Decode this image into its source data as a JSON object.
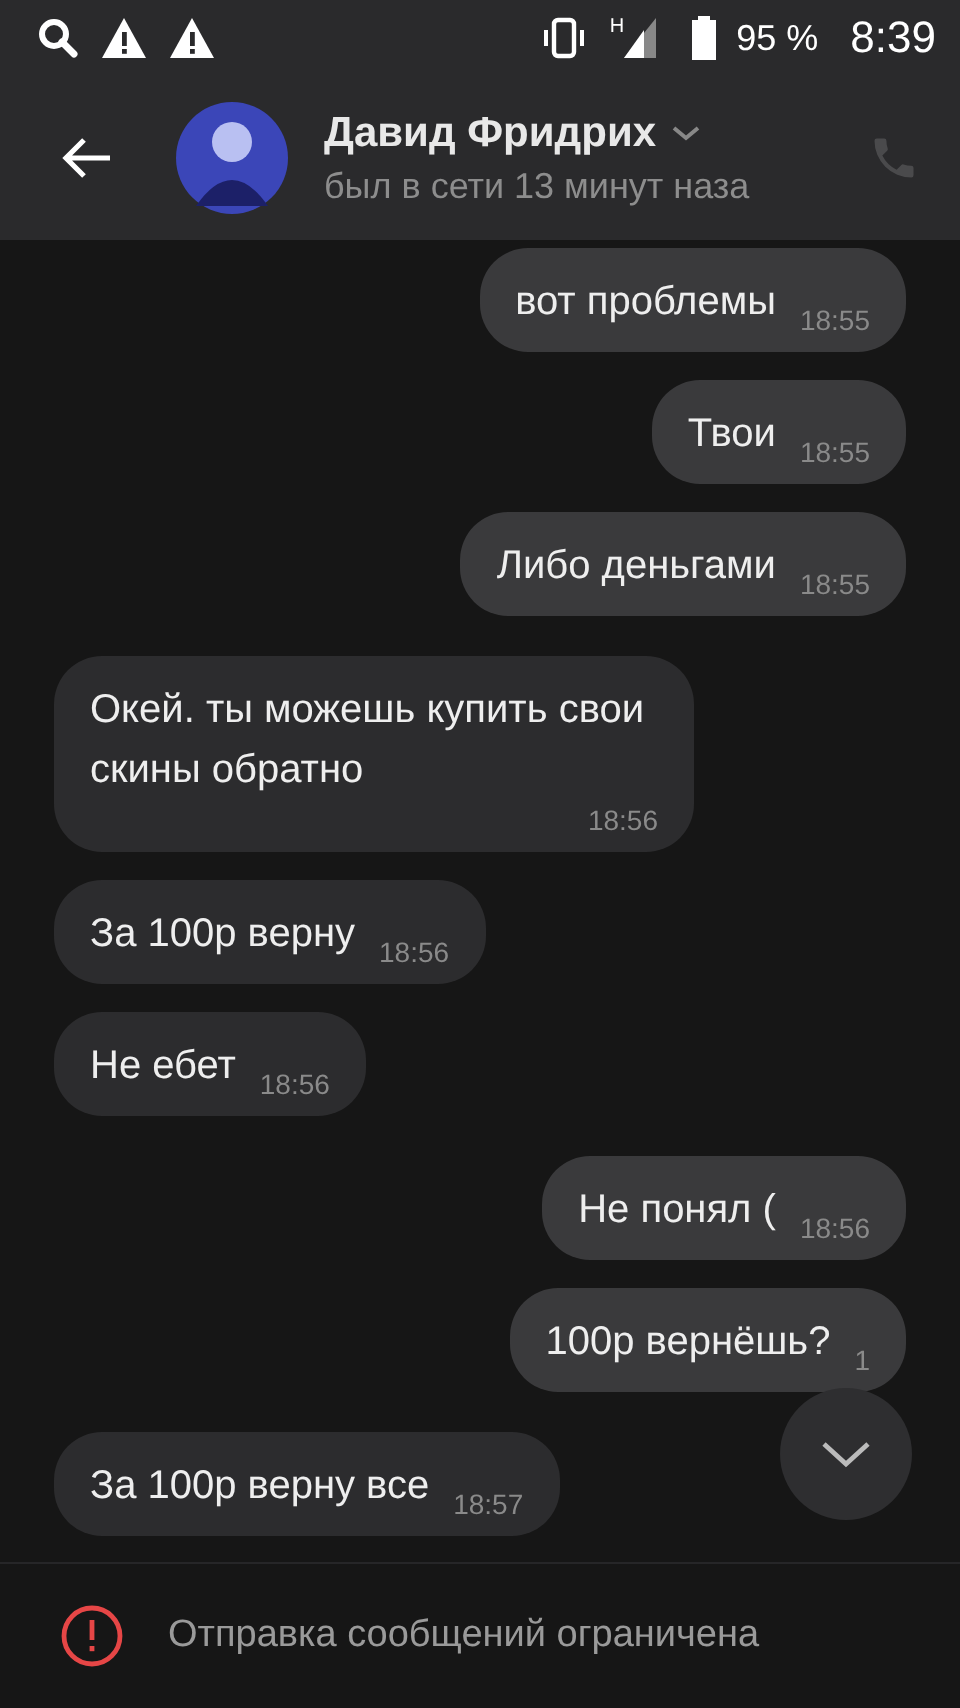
{
  "status_bar": {
    "battery": "95 %",
    "time": "8:39",
    "network": "H"
  },
  "header": {
    "name": "Давид Фридрих",
    "status": "был в сети 13 минут наза"
  },
  "messages": [
    {
      "text": "вот проблемы",
      "time": "18:55",
      "outgoing": true
    },
    {
      "text": "Твои",
      "time": "18:55",
      "outgoing": true
    },
    {
      "text": "Либо деньгами",
      "time": "18:55",
      "outgoing": true
    },
    {
      "text": "Окей. ты можешь купить свои скины обратно",
      "time": "18:56",
      "outgoing": false
    },
    {
      "text": "За 100р верну",
      "time": "18:56",
      "outgoing": false
    },
    {
      "text": "Не ебет",
      "time": "18:56",
      "outgoing": false
    },
    {
      "text": "Не понял (",
      "time": "18:56",
      "outgoing": true
    },
    {
      "text": "100р вернёшь?",
      "time": "1",
      "outgoing": true
    },
    {
      "text": "За 100р верну все",
      "time": "18:57",
      "outgoing": false
    }
  ],
  "footer": {
    "notice": "Отправка сообщений ограничена"
  }
}
